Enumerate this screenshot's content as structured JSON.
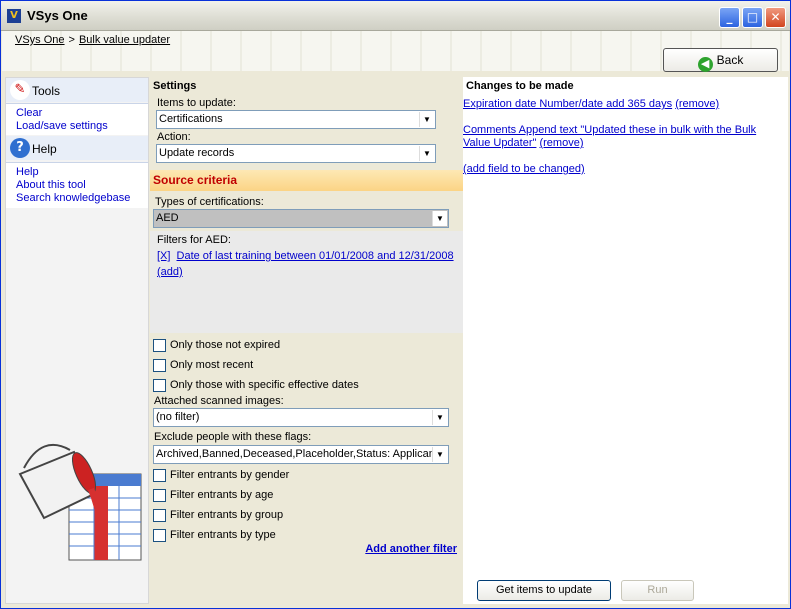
{
  "window": {
    "title": "VSys One",
    "minimize": "_",
    "maximize": "□",
    "close": "✕"
  },
  "breadcrumb": {
    "home": "VSys One",
    "separator": ">",
    "current": "Bulk value updater"
  },
  "back_button": {
    "label": "Back",
    "icon": "back-arrow-icon"
  },
  "sidebar": {
    "tools": {
      "title": "Tools",
      "icon": "tools-icon",
      "items": [
        "Clear",
        "Load/save settings"
      ]
    },
    "help": {
      "title": "Help",
      "icon": "help-icon",
      "items": [
        "Help",
        "About this tool",
        "Search knowledgebase"
      ]
    }
  },
  "settings": {
    "title": "Settings",
    "items_label": "Items to update:",
    "items_value": "Certifications",
    "action_label": "Action:",
    "action_value": "Update records",
    "source_title": "Source criteria",
    "types_label": "Types of certifications:",
    "types_value": "AED",
    "filters_label": "Filters for AED:",
    "filter_remove": "[X]",
    "filter_text": "Date of last training between 01/01/2008 and 12/31/2008",
    "filter_add": "(add)",
    "checks": [
      "Only those not expired",
      "Only most recent",
      "Only those with specific effective dates"
    ],
    "images_label": "Attached scanned images:",
    "images_value": "(no filter)",
    "flags_label": "Exclude people with these flags:",
    "flags_value": "Archived,Banned,Deceased,Placeholder,Status: Applican",
    "entrant_filters": [
      "Filter entrants by gender",
      "Filter entrants by age",
      "Filter entrants by group",
      "Filter entrants by type"
    ],
    "add_filter": "Add another filter"
  },
  "changes": {
    "title": "Changes to be made",
    "items": [
      {
        "text": "Expiration date Number/date add 365 days",
        "remove": "(remove)"
      },
      {
        "text": "Comments Append text \"Updated these in bulk with the Bulk Value Updater\"",
        "remove": "(remove)"
      }
    ],
    "add_field": "(add field to be changed)"
  },
  "footer": {
    "get_items": "Get items to update",
    "run": "Run"
  },
  "colors": {
    "accent": "#0000cc",
    "source_title": "#c00000",
    "source_bar": "#fbd485"
  }
}
